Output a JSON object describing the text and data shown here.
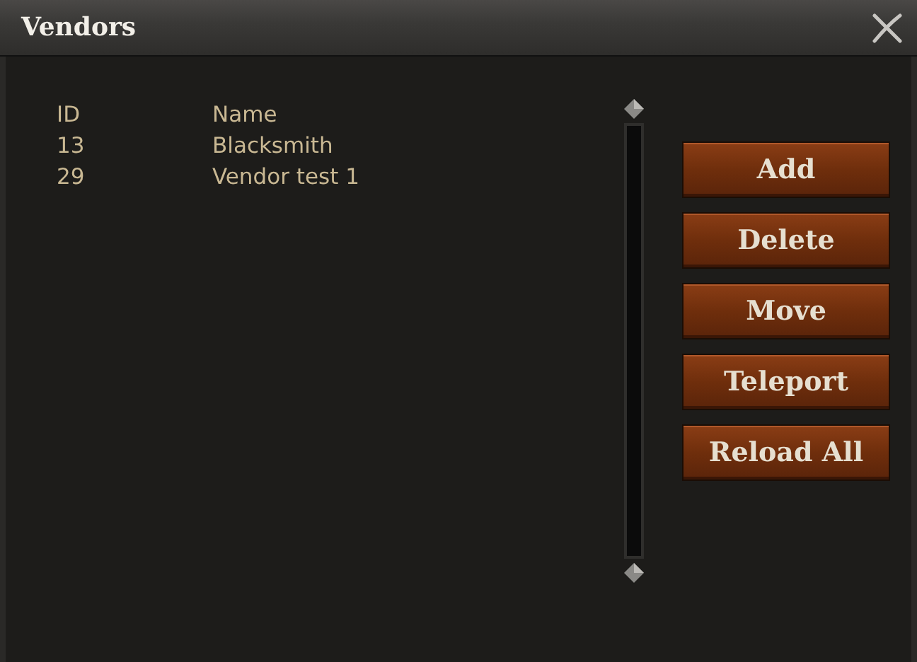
{
  "window": {
    "title": "Vendors"
  },
  "table": {
    "columns": [
      "ID",
      "Name"
    ],
    "rows": [
      [
        "13",
        "Blacksmith"
      ],
      [
        "29",
        "Vendor test 1"
      ]
    ]
  },
  "buttons": [
    "Add",
    "Delete",
    "Move",
    "Teleport",
    "Reload All"
  ]
}
